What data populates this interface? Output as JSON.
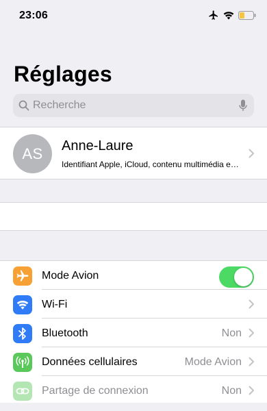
{
  "status_bar": {
    "time": "23:06",
    "icons": [
      "airplane-icon",
      "wifi-icon",
      "battery-icon"
    ],
    "battery_color": "#f5c542"
  },
  "header": {
    "title": "Réglages"
  },
  "search": {
    "placeholder": "Recherche",
    "icons": [
      "search-icon",
      "microphone-icon"
    ]
  },
  "profile": {
    "initials": "AS",
    "name": "Anne-Laure",
    "subtitle": "Identifiant Apple, iCloud, contenu multimédia et achats"
  },
  "settings": {
    "items": [
      {
        "label": "Mode Avion",
        "icon": "airplane-icon",
        "icon_color": "#f7a033",
        "toggle": true,
        "toggle_color": "#4cd964"
      },
      {
        "label": "Wi-Fi",
        "icon": "wifi-icon",
        "icon_color": "#2f7cf6",
        "value": ""
      },
      {
        "label": "Bluetooth",
        "icon": "bluetooth-icon",
        "icon_color": "#2f7cf6",
        "value": "Non"
      },
      {
        "label": "Données cellulaires",
        "icon": "cellular-antenna-icon",
        "icon_color": "#5ac85a",
        "value": "Mode Avion"
      },
      {
        "label": "Partage de connexion",
        "icon": "hotspot-icon",
        "icon_color": "#5ac85a",
        "value": "Non",
        "disabled": true
      }
    ]
  }
}
